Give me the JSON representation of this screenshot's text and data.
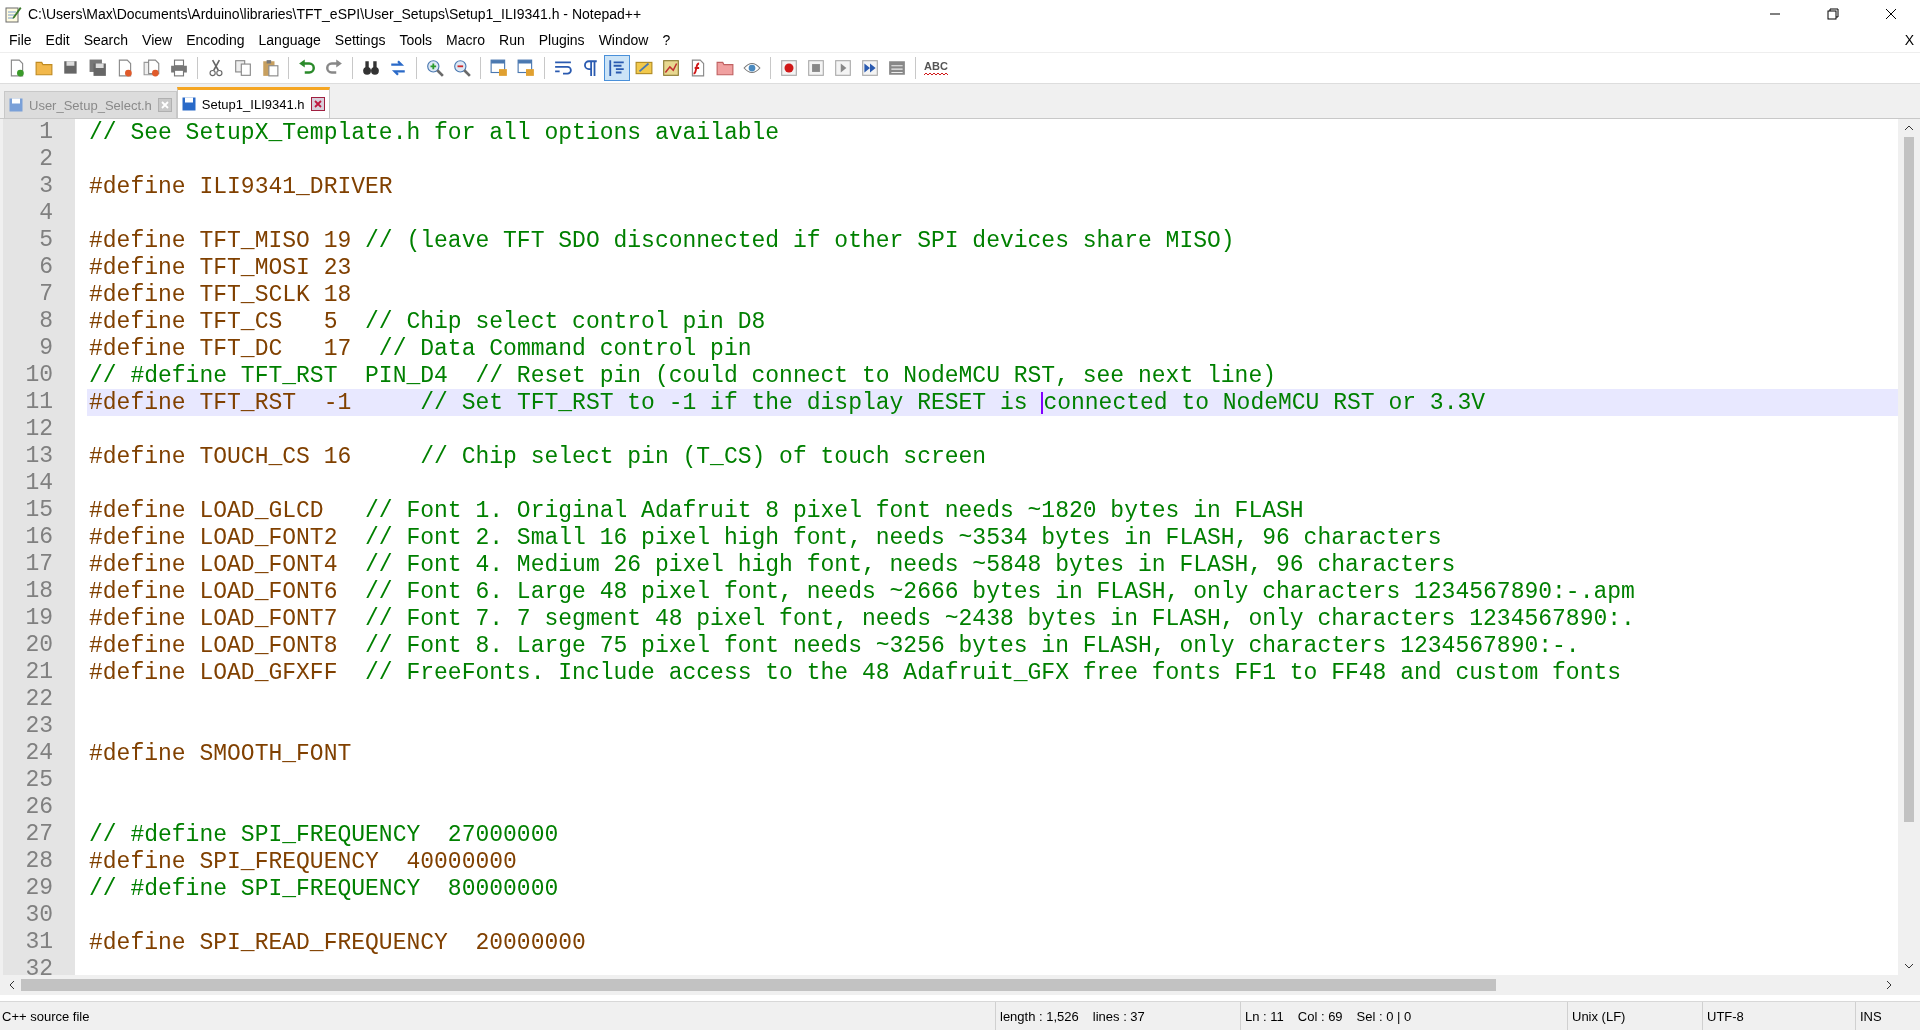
{
  "window": {
    "title": "C:\\Users\\Max\\Documents\\Arduino\\libraries\\TFT_eSPI\\User_Setups\\Setup1_ILI9341.h - Notepad++"
  },
  "menu": [
    "File",
    "Edit",
    "Search",
    "View",
    "Encoding",
    "Language",
    "Settings",
    "Tools",
    "Macro",
    "Run",
    "Plugins",
    "Window",
    "?"
  ],
  "close_document": "X",
  "toolbar": [
    {
      "selected": false
    },
    {
      "selected": false
    },
    {
      "selected": false
    },
    {
      "selected": false
    },
    {
      "selected": false
    },
    {
      "selected": false
    },
    {
      "selected": false
    },
    {
      "selected": false
    },
    {
      "selected": false
    },
    {
      "selected": false
    },
    {
      "selected": false
    },
    {
      "selected": false
    },
    {
      "selected": false
    },
    {
      "selected": false
    },
    {
      "selected": false
    },
    {
      "selected": false
    },
    {
      "selected": false
    },
    {
      "selected": false
    },
    {
      "selected": false
    },
    {
      "selected": false
    },
    {
      "selected": true
    },
    {
      "selected": false
    },
    {
      "selected": false
    },
    {
      "selected": false
    },
    {
      "selected": false
    },
    {
      "selected": false
    },
    {
      "selected": false
    },
    {
      "selected": false
    },
    {
      "selected": false
    },
    {
      "selected": false
    },
    {
      "selected": false
    }
  ],
  "spellcheck_label": "ABC",
  "tabs": [
    {
      "label": "User_Setup_Select.h",
      "selected": false
    },
    {
      "label": "Setup1_ILI9341.h",
      "selected": true
    }
  ],
  "editor": {
    "lines": [
      {
        "number": "1",
        "current": false,
        "segments": [
          {
            "kind": "comment",
            "text": "// See SetupX_Template.h for all options available"
          }
        ]
      },
      {
        "number": "2",
        "current": false
      },
      {
        "number": "3",
        "current": false,
        "segments": [
          {
            "kind": "code",
            "text": "#define ILI9341_DRIVER"
          }
        ]
      },
      {
        "number": "4",
        "current": false
      },
      {
        "number": "5",
        "current": false,
        "segments": [
          {
            "kind": "code",
            "text": "#define TFT_MISO 19 "
          },
          {
            "kind": "comment",
            "text": "// (leave TFT SDO disconnected if other SPI devices share MISO)"
          }
        ]
      },
      {
        "number": "6",
        "current": false,
        "segments": [
          {
            "kind": "code",
            "text": "#define TFT_MOSI 23"
          }
        ]
      },
      {
        "number": "7",
        "current": false,
        "segments": [
          {
            "kind": "code",
            "text": "#define TFT_SCLK 18"
          }
        ]
      },
      {
        "number": "8",
        "current": false,
        "segments": [
          {
            "kind": "code",
            "text": "#define TFT_CS   5  "
          },
          {
            "kind": "comment",
            "text": "// Chip select control pin D8"
          }
        ]
      },
      {
        "number": "9",
        "current": false,
        "segments": [
          {
            "kind": "code",
            "text": "#define TFT_DC   17  "
          },
          {
            "kind": "comment",
            "text": "// Data Command control pin"
          }
        ]
      },
      {
        "number": "10",
        "current": false,
        "segments": [
          {
            "kind": "comment",
            "text": "// #define TFT_RST  PIN_D4  // Reset pin (could connect to NodeMCU RST, see next line)"
          }
        ]
      },
      {
        "number": "11",
        "current": true,
        "segments": [
          {
            "kind": "code",
            "text": "#define TFT_RST  -1     "
          },
          {
            "kind": "comment",
            "text": "// Set TFT_RST to -1 if the display RESET is "
          },
          {
            "kind": "caret"
          },
          {
            "kind": "comment",
            "text": "connected to NodeMCU RST or 3.3V"
          }
        ]
      },
      {
        "number": "12",
        "current": false
      },
      {
        "number": "13",
        "current": false,
        "segments": [
          {
            "kind": "code",
            "text": "#define TOUCH_CS 16     "
          },
          {
            "kind": "comment",
            "text": "// Chip select pin (T_CS) of touch screen"
          }
        ]
      },
      {
        "number": "14",
        "current": false
      },
      {
        "number": "15",
        "current": false,
        "segments": [
          {
            "kind": "code",
            "text": "#define LOAD_GLCD   "
          },
          {
            "kind": "comment",
            "text": "// Font 1. Original Adafruit 8 pixel font needs ~1820 bytes in FLASH"
          }
        ]
      },
      {
        "number": "16",
        "current": false,
        "segments": [
          {
            "kind": "code",
            "text": "#define LOAD_FONT2  "
          },
          {
            "kind": "comment",
            "text": "// Font 2. Small 16 pixel high font, needs ~3534 bytes in FLASH, 96 characters"
          }
        ]
      },
      {
        "number": "17",
        "current": false,
        "segments": [
          {
            "kind": "code",
            "text": "#define LOAD_FONT4  "
          },
          {
            "kind": "comment",
            "text": "// Font 4. Medium 26 pixel high font, needs ~5848 bytes in FLASH, 96 characters"
          }
        ]
      },
      {
        "number": "18",
        "current": false,
        "segments": [
          {
            "kind": "code",
            "text": "#define LOAD_FONT6  "
          },
          {
            "kind": "comment",
            "text": "// Font 6. Large 48 pixel font, needs ~2666 bytes in FLASH, only characters 1234567890:-.apm"
          }
        ]
      },
      {
        "number": "19",
        "current": false,
        "segments": [
          {
            "kind": "code",
            "text": "#define LOAD_FONT7  "
          },
          {
            "kind": "comment",
            "text": "// Font 7. 7 segment 48 pixel font, needs ~2438 bytes in FLASH, only characters 1234567890:."
          }
        ]
      },
      {
        "number": "20",
        "current": false,
        "segments": [
          {
            "kind": "code",
            "text": "#define LOAD_FONT8  "
          },
          {
            "kind": "comment",
            "text": "// Font 8. Large 75 pixel font needs ~3256 bytes in FLASH, only characters 1234567890:-."
          }
        ]
      },
      {
        "number": "21",
        "current": false,
        "segments": [
          {
            "kind": "code",
            "text": "#define LOAD_GFXFF  "
          },
          {
            "kind": "comment",
            "text": "// FreeFonts. Include access to the 48 Adafruit_GFX free fonts FF1 to FF48 and custom fonts"
          }
        ]
      },
      {
        "number": "22",
        "current": false
      },
      {
        "number": "23",
        "current": false
      },
      {
        "number": "24",
        "current": false,
        "segments": [
          {
            "kind": "code",
            "text": "#define SMOOTH_FONT"
          }
        ]
      },
      {
        "number": "25",
        "current": false
      },
      {
        "number": "26",
        "current": false
      },
      {
        "number": "27",
        "current": false,
        "segments": [
          {
            "kind": "comment",
            "text": "// #define SPI_FREQUENCY  27000000"
          }
        ]
      },
      {
        "number": "28",
        "current": false,
        "segments": [
          {
            "kind": "code",
            "text": "#define SPI_FREQUENCY  40000000"
          }
        ]
      },
      {
        "number": "29",
        "current": false,
        "segments": [
          {
            "kind": "comment",
            "text": "// #define SPI_FREQUENCY  80000000"
          }
        ]
      },
      {
        "number": "30",
        "current": false
      },
      {
        "number": "31",
        "current": false,
        "segments": [
          {
            "kind": "code",
            "text": "#define SPI_READ_FREQUENCY  20000000"
          }
        ]
      },
      {
        "number": "32",
        "current": false
      }
    ]
  },
  "status_bar": {
    "file_type": "C++ source file",
    "sections": [
      [
        "length : 1,526",
        "lines : 37"
      ],
      [
        "Ln : 11",
        "Col : 69",
        "Sel : 0 | 0"
      ],
      [
        "Unix (LF)"
      ],
      [
        "UTF-8"
      ],
      [
        "INS"
      ]
    ]
  }
}
